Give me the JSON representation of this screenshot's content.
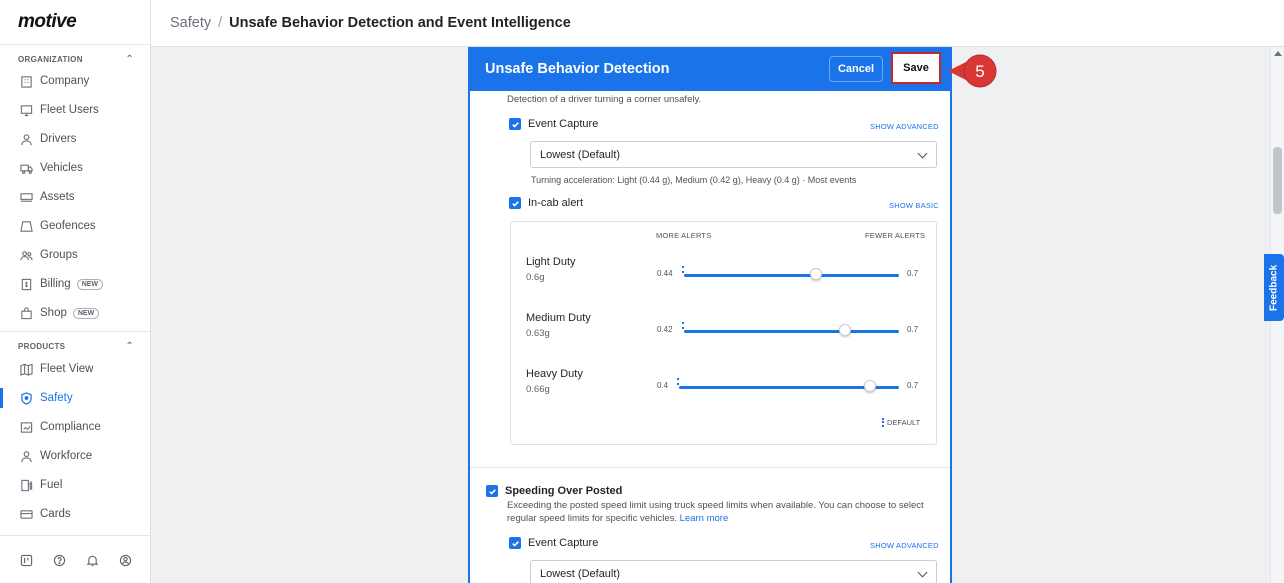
{
  "sidebar": {
    "logo": "motive",
    "sections": [
      {
        "title": "ORGANIZATION",
        "items": [
          {
            "label": "Company",
            "icon": "building-icon"
          },
          {
            "label": "Fleet Users",
            "icon": "monitor-icon"
          },
          {
            "label": "Drivers",
            "icon": "person-icon"
          },
          {
            "label": "Vehicles",
            "icon": "truck-icon"
          },
          {
            "label": "Assets",
            "icon": "trailer-icon"
          },
          {
            "label": "Geofences",
            "icon": "geofence-icon"
          },
          {
            "label": "Groups",
            "icon": "group-icon"
          },
          {
            "label": "Billing",
            "icon": "billing-icon",
            "badge": "NEW"
          },
          {
            "label": "Shop",
            "icon": "bag-icon",
            "badge": "NEW"
          }
        ]
      },
      {
        "title": "PRODUCTS",
        "items": [
          {
            "label": "Fleet View",
            "icon": "map-icon"
          },
          {
            "label": "Safety",
            "icon": "shield-icon",
            "active": true
          },
          {
            "label": "Compliance",
            "icon": "compliance-icon"
          },
          {
            "label": "Workforce",
            "icon": "person-icon"
          },
          {
            "label": "Fuel",
            "icon": "fuel-icon"
          },
          {
            "label": "Cards",
            "icon": "card-icon"
          }
        ]
      }
    ],
    "footer_icons": [
      "apps-icon",
      "help-icon",
      "bell-icon",
      "account-icon"
    ]
  },
  "header": {
    "breadcrumb_root": "Safety",
    "breadcrumb_sep": "/",
    "breadcrumb_current": "Unsafe Behavior Detection and Event Intelligence"
  },
  "panel": {
    "title": "Unsafe Behavior Detection",
    "cancel_label": "Cancel",
    "save_label": "Save",
    "cornering": {
      "description": "Detection of a driver turning a corner unsafely.",
      "event_capture_label": "Event Capture",
      "event_capture_checked": true,
      "show_advanced": "SHOW ADVANCED",
      "sensitivity_value": "Lowest (Default)",
      "sensitivity_hint": "Turning acceleration: Light (0.44 g), Medium (0.42 g), Heavy (0.4 g)  ·  Most events",
      "in_cab_label": "In-cab alert",
      "in_cab_checked": true,
      "show_basic": "SHOW BASIC",
      "more_alerts": "MORE ALERTS",
      "fewer_alerts": "FEWER ALERTS",
      "duties": [
        {
          "name": "Light Duty",
          "value": "0.6g",
          "min": "0.44",
          "max": "0.7",
          "level": 0.6
        },
        {
          "name": "Medium Duty",
          "value": "0.63g",
          "min": "0.42",
          "max": "0.7",
          "level": 0.63
        },
        {
          "name": "Heavy Duty",
          "value": "0.66g",
          "min": "0.4",
          "max": "0.7",
          "level": 0.66
        }
      ],
      "default_note": "DEFAULT"
    },
    "speeding": {
      "title": "Speeding Over Posted",
      "checked": true,
      "description_1": "Exceeding the posted speed limit using truck speed limits when available. You can choose to select",
      "description_2": "regular speed limits for specific vehicles.",
      "learn_more": "Learn more",
      "event_capture_label": "Event Capture",
      "show_advanced": "SHOW ADVANCED",
      "sensitivity_value": "Lowest (Default)"
    }
  },
  "feedback_label": "Feedback",
  "step_number": "5",
  "colors": {
    "accent": "#1a73e8",
    "callout": "#d93636"
  }
}
